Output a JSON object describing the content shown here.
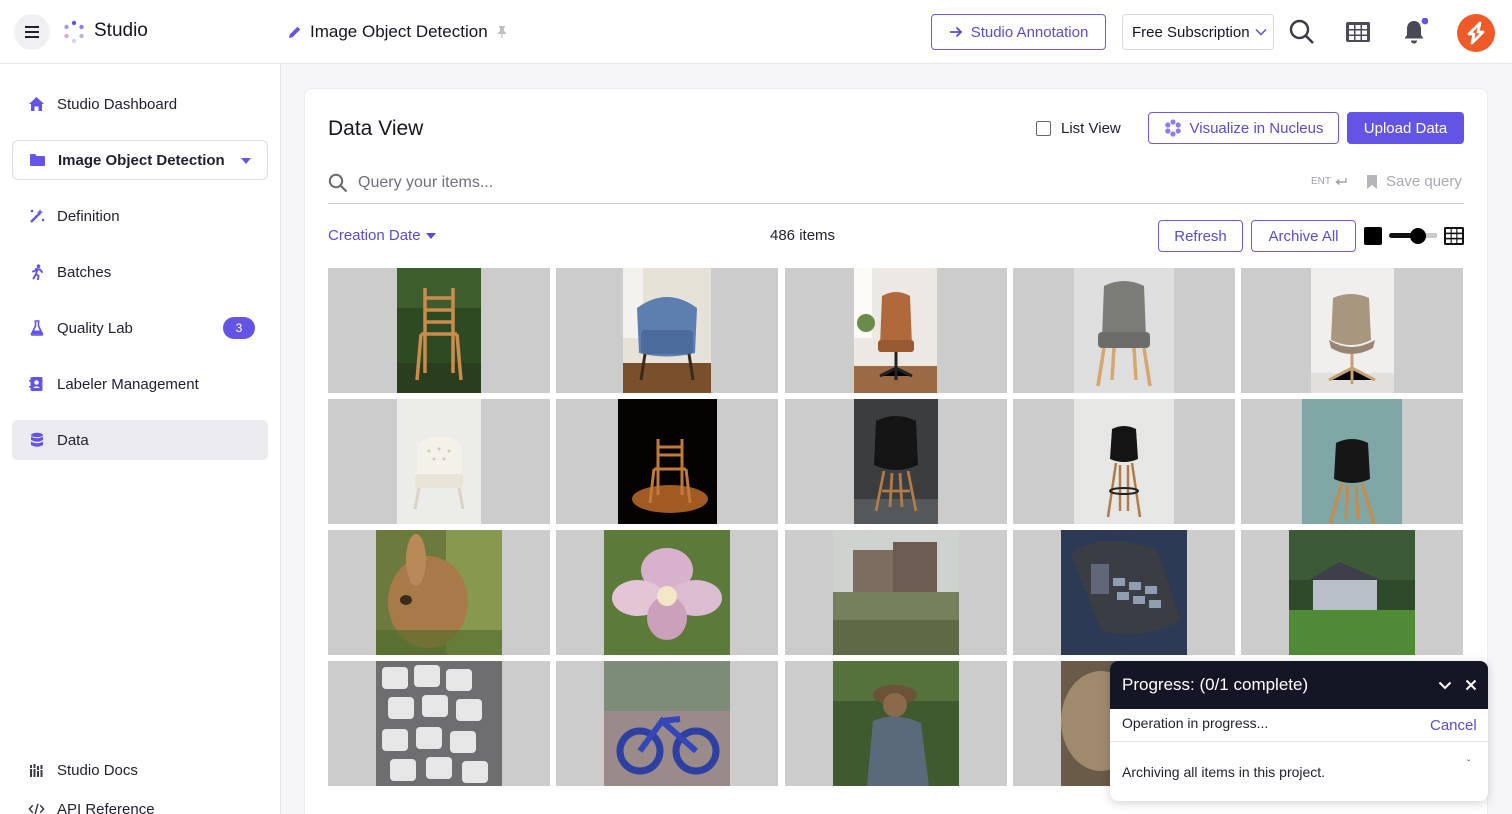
{
  "topbar": {
    "app_name": "Studio",
    "project_title": "Image Object Detection",
    "studio_annotation_label": "Studio Annotation",
    "subscription_label": "Free Subscription",
    "avatar_color": "#f05a28",
    "notification_dot_color": "#6354e6"
  },
  "sidebar": {
    "items": [
      {
        "label": "Studio Dashboard",
        "icon": "home-icon"
      },
      {
        "label": "Image Object Detection",
        "icon": "folder-icon"
      },
      {
        "label": "Definition",
        "icon": "wand-icon"
      },
      {
        "label": "Batches",
        "icon": "runner-icon"
      },
      {
        "label": "Quality Lab",
        "icon": "flask-icon",
        "badge": "3"
      },
      {
        "label": "Labeler Management",
        "icon": "id-card-icon"
      },
      {
        "label": "Data",
        "icon": "database-icon"
      }
    ],
    "footer": [
      {
        "label": "Studio Docs",
        "icon": "library-icon"
      },
      {
        "label": "API Reference",
        "icon": "code-icon"
      }
    ]
  },
  "main": {
    "title": "Data View",
    "list_view_label": "List View",
    "visualize_label": "Visualize in Nucleus",
    "upload_label": "Upload Data",
    "search": {
      "placeholder": "Query your items...",
      "ent_hint": "ENT",
      "save_query_label": "Save query"
    },
    "sort_label": "Creation Date",
    "item_count": "486 items",
    "refresh_label": "Refresh",
    "archive_all_label": "Archive All",
    "thumbnail_size_level": 0.66,
    "accent_color": "#6354e6"
  },
  "toast": {
    "title": "Progress: (0/1 complete)",
    "operation": "Operation in progress...",
    "cancel_label": "Cancel",
    "message": "Archiving all items in this project.",
    "mini": "ˇ"
  }
}
